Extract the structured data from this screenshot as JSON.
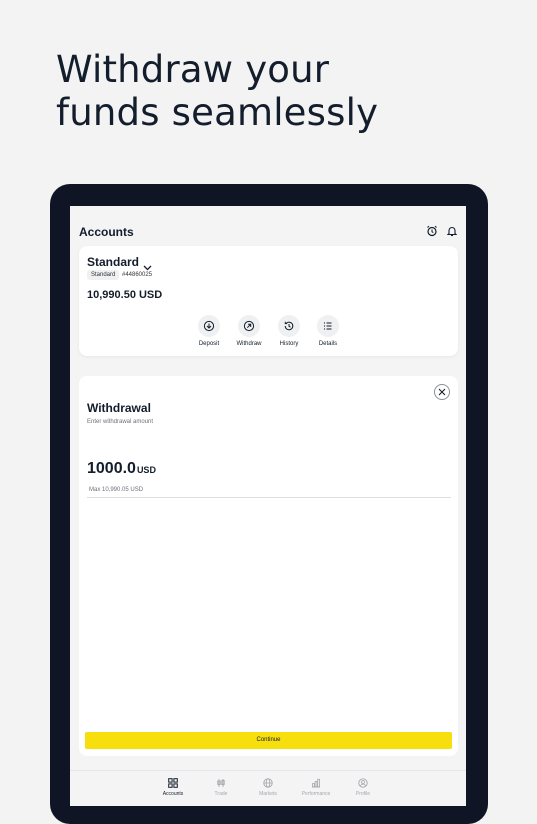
{
  "headline": {
    "line1": "Withdraw your",
    "line2": "funds seamlessly"
  },
  "app": {
    "title": "Accounts",
    "icons": [
      "alarm-icon",
      "bell-icon"
    ]
  },
  "account": {
    "name": "Standard",
    "type_badge": "Standard",
    "number": "#44860025",
    "balance": "10,990.50 USD",
    "actions": [
      {
        "label": "Deposit",
        "icon": "deposit-icon"
      },
      {
        "label": "Withdraw",
        "icon": "withdraw-icon"
      },
      {
        "label": "History",
        "icon": "history-icon"
      },
      {
        "label": "Details",
        "icon": "details-icon"
      }
    ]
  },
  "withdrawal": {
    "title": "Withdrawal",
    "subtitle": "Enter withdrawal amount",
    "amount": "1000.0",
    "currency": "USD",
    "max_text": "Max 10,990.05 USD",
    "continue_label": "Continue"
  },
  "nav": {
    "items": [
      {
        "label": "Accounts",
        "icon": "accounts-icon",
        "active": true
      },
      {
        "label": "Trade",
        "icon": "trade-icon",
        "active": false
      },
      {
        "label": "Markets",
        "icon": "globe-icon",
        "active": false
      },
      {
        "label": "Performance",
        "icon": "chart-icon",
        "active": false
      },
      {
        "label": "Profile",
        "icon": "profile-icon",
        "active": false
      }
    ]
  },
  "colors": {
    "accent": "#f7de0d",
    "frame": "#0f1525",
    "text": "#141d2b"
  }
}
